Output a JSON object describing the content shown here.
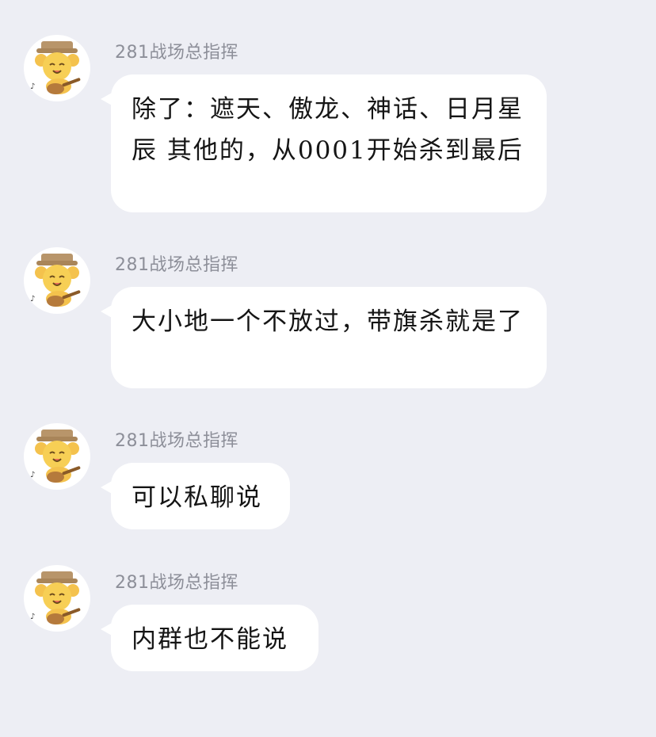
{
  "messages": [
    {
      "sender": "281战场总指挥",
      "text": "除了：遮天、傲龙、神话、日月星辰 其他的，从0001开始杀到最后"
    },
    {
      "sender": "281战场总指挥",
      "text": "大小地一个不放过，带旗杀就是了"
    },
    {
      "sender": "281战场总指挥",
      "text": "可以私聊说"
    },
    {
      "sender": "281战场总指挥",
      "text": "内群也不能说"
    }
  ],
  "icons": {
    "avatar": "cartoon-lion-guitar-avatar-icon"
  },
  "colors": {
    "background": "#edeef4",
    "bubble": "#ffffff",
    "sender": "#8d8f99",
    "text": "#151515"
  }
}
